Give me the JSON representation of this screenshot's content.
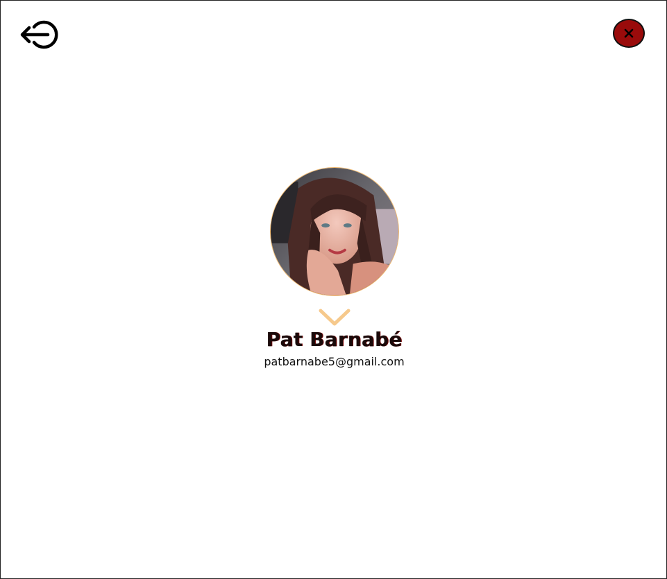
{
  "header": {
    "logout_icon": "logout-arrow-icon",
    "close_icon": "close-icon"
  },
  "profile": {
    "name": "Pat Barnabé",
    "email": "patbarnabe5@gmail.com",
    "expand_icon": "chevron-down-icon"
  },
  "colors": {
    "close_button": "#9a0b0b",
    "avatar_ring": "#f2b96d",
    "chevron": "#f6c98c",
    "name_text": "#1a0a0a"
  }
}
